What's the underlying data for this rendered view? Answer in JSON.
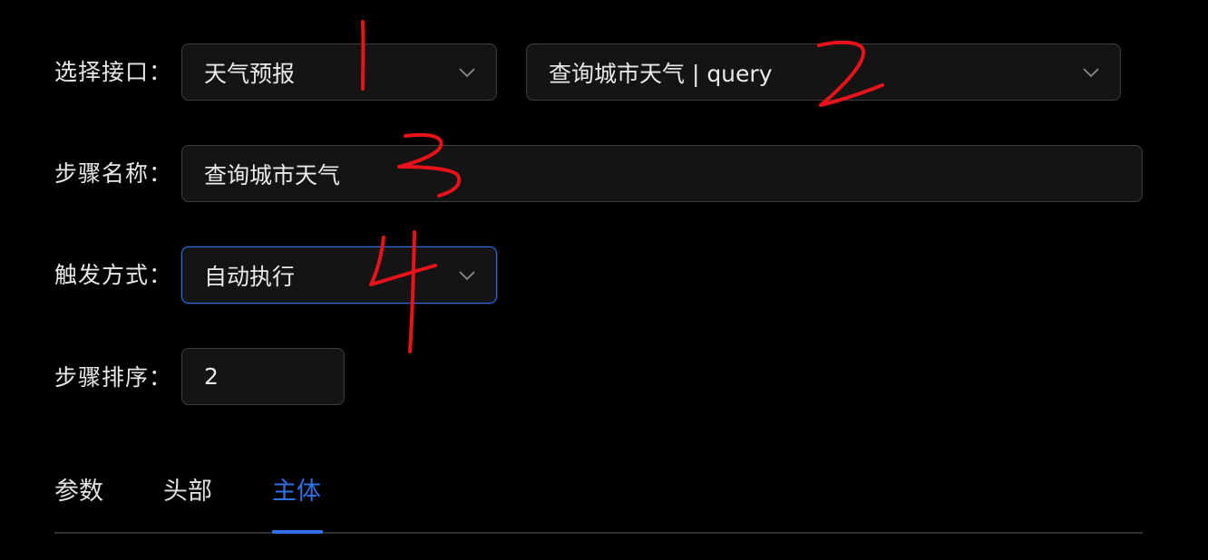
{
  "form": {
    "interface_label": "选择接口：",
    "interface_group_value": "天气预报",
    "interface_api_value": "查询城市天气 | query",
    "step_name_label": "步骤名称：",
    "step_name_value": "查询城市天气",
    "trigger_label": "触发方式：",
    "trigger_value": "自动执行",
    "order_label": "步骤排序：",
    "order_value": "2"
  },
  "tabs": [
    {
      "label": "参数",
      "active": false
    },
    {
      "label": "头部",
      "active": false
    },
    {
      "label": "主体",
      "active": true
    }
  ],
  "colors": {
    "background": "#000000",
    "field_bg": "#141414",
    "accent_blue": "#2f72e6",
    "annotation_red": "#e8131a"
  },
  "annotations": [
    "1",
    "2",
    "3",
    "4"
  ]
}
